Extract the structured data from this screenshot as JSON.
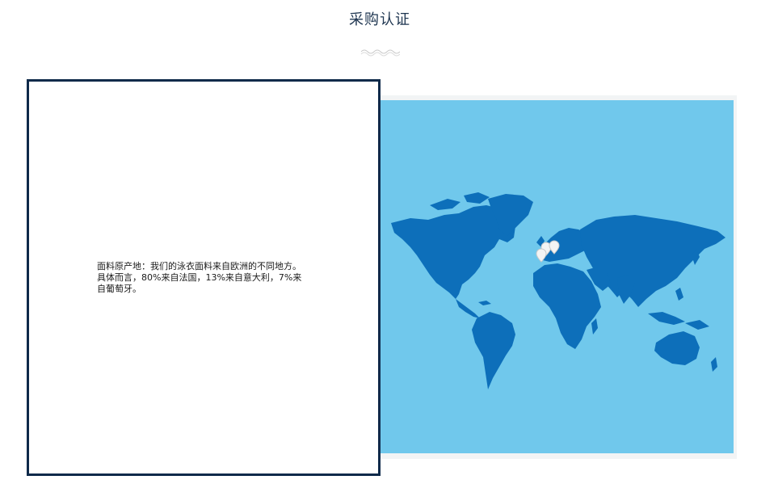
{
  "header": {
    "title": "采购认证"
  },
  "origin_card": {
    "text": "面料原产地：我们的泳衣面料来自欧洲的不同地方。具体而言，80%来自法国，13%来自意大利，7%来自葡萄牙。"
  },
  "map": {
    "markers": [
      "marker-france",
      "marker-italy",
      "marker-portugal"
    ],
    "colors": {
      "ocean": "#70c8ec",
      "land": "#0d6fba",
      "marker": "#f4f4f4"
    }
  }
}
